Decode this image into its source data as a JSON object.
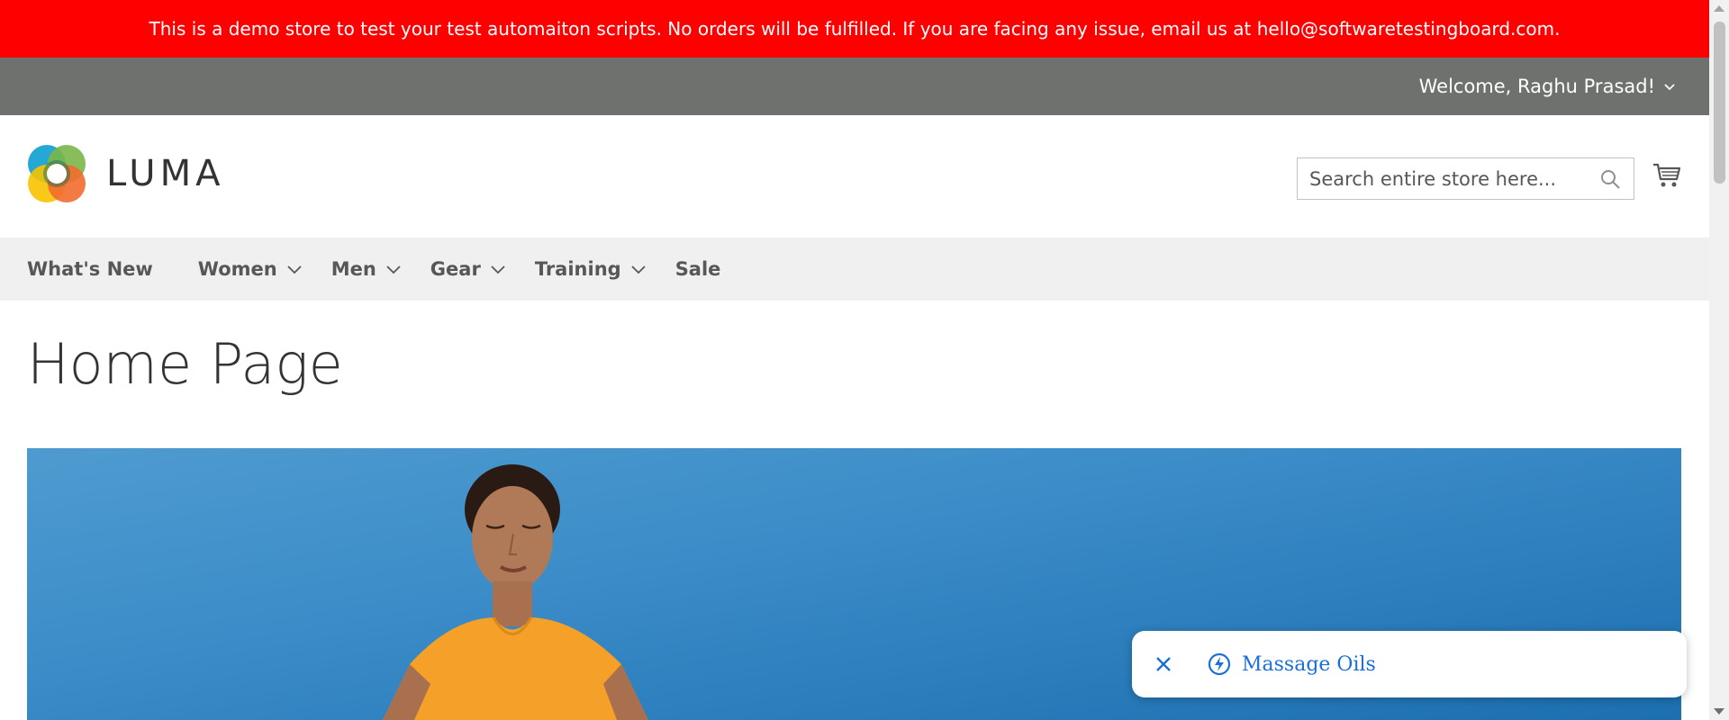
{
  "notice": {
    "text": "This is a demo store to test your test automaiton scripts. No orders will be fulfilled. If you are facing any issue, email us at hello@softwaretestingboard.com."
  },
  "header": {
    "welcome": "Welcome, Raghu Prasad!",
    "logo_text": "LUMA",
    "search_placeholder": "Search entire store here..."
  },
  "nav": {
    "items": [
      {
        "label": "What's New",
        "has_dropdown": false
      },
      {
        "label": "Women",
        "has_dropdown": true
      },
      {
        "label": "Men",
        "has_dropdown": true
      },
      {
        "label": "Gear",
        "has_dropdown": true
      },
      {
        "label": "Training",
        "has_dropdown": true
      },
      {
        "label": "Sale",
        "has_dropdown": false
      }
    ]
  },
  "main": {
    "page_title": "Home Page"
  },
  "suggestion": {
    "label": "Massage Oils",
    "icon": "bolt-icon",
    "close_icon": "close-icon"
  },
  "colors": {
    "notice_bg": "#ff0000",
    "header_bg": "#6e716e",
    "nav_bg": "#f0f0f0",
    "link": "#1a6fd8"
  }
}
